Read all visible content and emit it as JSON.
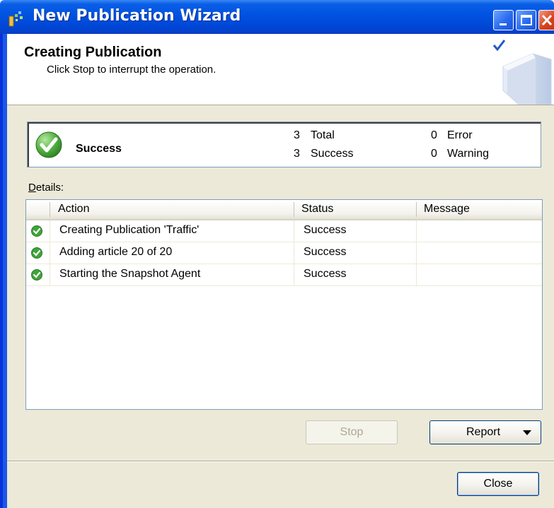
{
  "window": {
    "title": "New Publication Wizard",
    "colors": {
      "titlebar": "#0052e0",
      "body": "#ece9d8",
      "accent_green": "#3fa33a"
    }
  },
  "header": {
    "title": "Creating Publication",
    "subtitle": "Click Stop to interrupt the operation."
  },
  "summary": {
    "status": "Success",
    "total_count": "3",
    "total_label": "Total",
    "success_count": "3",
    "success_label": "Success",
    "error_count": "0",
    "error_label": "Error",
    "warning_count": "0",
    "warning_label": "Warning"
  },
  "details": {
    "label_accel": "D",
    "label_rest": "etails:",
    "columns": {
      "action": "Action",
      "status": "Status",
      "message": "Message"
    },
    "rows": [
      {
        "icon": "success-check-icon",
        "action": "Creating Publication 'Traffic'",
        "status": "Success",
        "message": ""
      },
      {
        "icon": "success-check-icon",
        "action": "Adding article 20 of 20",
        "status": "Success",
        "message": ""
      },
      {
        "icon": "success-check-icon",
        "action": "Starting the Snapshot Agent",
        "status": "Success",
        "message": ""
      }
    ]
  },
  "buttons": {
    "stop": "Stop",
    "report": "Report",
    "close": "Close"
  }
}
